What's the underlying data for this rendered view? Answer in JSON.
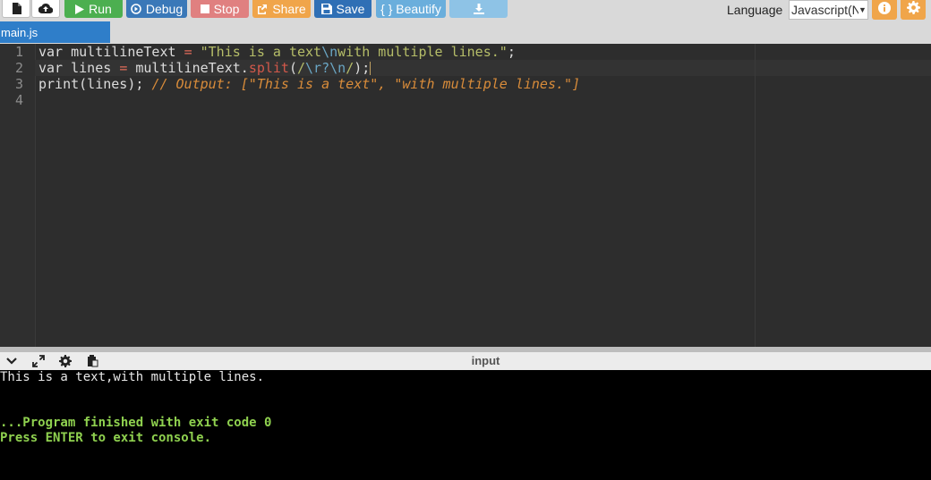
{
  "toolbar": {
    "buttons": [
      {
        "label": "Run",
        "icon": "play-icon",
        "color": "#4caf50"
      },
      {
        "label": "Debug",
        "icon": "debug-icon",
        "color": "#3a78b8"
      },
      {
        "label": "Stop",
        "icon": "stop-icon",
        "color": "#e08080"
      },
      {
        "label": "Share",
        "icon": "share-icon",
        "color": "#f0a54a"
      },
      {
        "label": "Save",
        "icon": "save-icon",
        "color": "#2f6fb5"
      },
      {
        "label": "{ } Beautify",
        "icon": "",
        "color": "#6aaedc"
      }
    ],
    "language_label": "Language",
    "language_value": "Javascript(N"
  },
  "tabs": [
    {
      "label": "main.js"
    }
  ],
  "editor": {
    "line_numbers": [
      "1",
      "2",
      "3",
      "4"
    ],
    "lines": [
      "var multilineText = \"This is a text\\nwith multiple lines.\";",
      "var lines = multilineText.split(/\\r?\\n/);",
      "print(lines); // Output: [\"This is a text\", \"with multiple lines.\"]",
      ""
    ]
  },
  "console": {
    "title": "input",
    "lines": [
      "This is a text,with multiple lines.",
      "",
      "",
      "...Program finished with exit code 0",
      "Press ENTER to exit console."
    ]
  },
  "colors": {
    "accent": "#2f7ec9",
    "run": "#4caf50",
    "orange": "#f0a54a",
    "editor_bg": "#2d2d2d",
    "console_bg": "#000000",
    "console_success": "#8fd14f"
  }
}
